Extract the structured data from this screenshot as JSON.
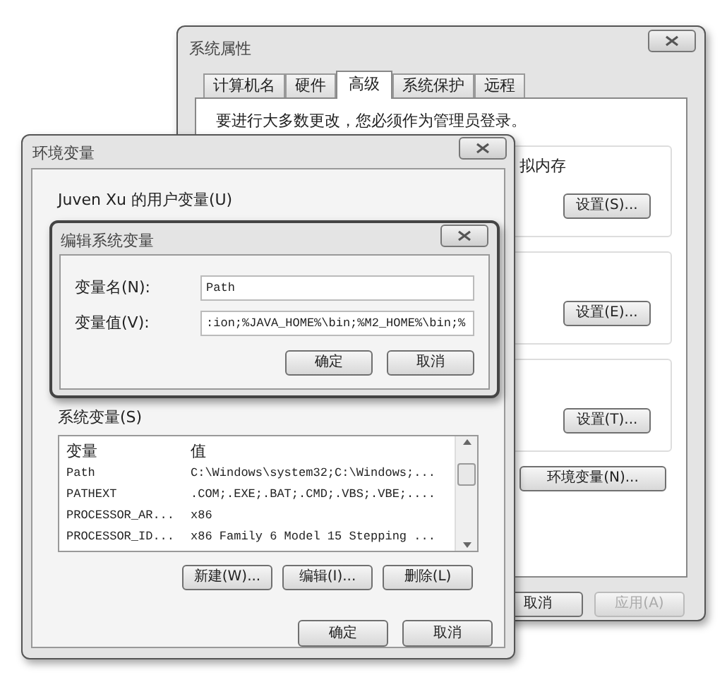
{
  "system_properties": {
    "title": "系统属性",
    "tabs": [
      {
        "label": "计算机名",
        "selected": false
      },
      {
        "label": "硬件",
        "selected": false
      },
      {
        "label": "高级",
        "selected": true
      },
      {
        "label": "系统保护",
        "selected": false
      },
      {
        "label": "远程",
        "selected": false
      }
    ],
    "notice": "要进行大多数更改，您必须作为管理员登录。",
    "sections": [
      {
        "text": "拟内存",
        "button": "设置(S)..."
      },
      {
        "button": "设置(E)..."
      },
      {
        "button": "设置(T)..."
      }
    ],
    "env_button": "环境变量(N)...",
    "buttons": [
      {
        "label": "取消",
        "disabled": false
      },
      {
        "label": "应用(A)",
        "disabled": true
      }
    ]
  },
  "environment_variables": {
    "title": "环境变量",
    "user_vars_label": "Juven Xu 的用户变量(U)",
    "system_vars_label": "系统变量(S)",
    "table": {
      "columns": [
        "变量",
        "值"
      ],
      "rows": [
        [
          "Path",
          "C:\\Windows\\system32;C:\\Windows;..."
        ],
        [
          "PATHEXT",
          ".COM;.EXE;.BAT;.CMD;.VBS;.VBE;...."
        ],
        [
          "PROCESSOR_AR...",
          "x86"
        ],
        [
          "PROCESSOR_ID...",
          "x86 Family 6 Model 15 Stepping ..."
        ]
      ]
    },
    "buttons": [
      "新建(W)...",
      "编辑(I)...",
      "删除(L)"
    ],
    "dialog_buttons": [
      "确定",
      "取消"
    ]
  },
  "edit_dialog": {
    "title": "编辑系统变量",
    "fields": [
      {
        "label": "变量名(N):",
        "value": "Path"
      },
      {
        "label": "变量值(V):",
        "value": ":ion;%JAVA_HOME%\\bin;%M2_HOME%\\bin;%"
      }
    ],
    "buttons": [
      "确定",
      "取消"
    ]
  }
}
